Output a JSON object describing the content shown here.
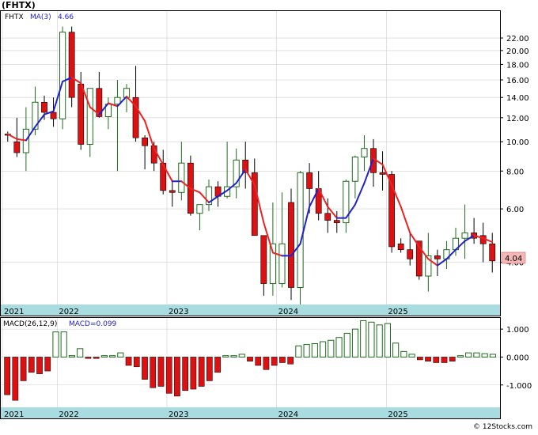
{
  "header": {
    "ticker_title": "(FHTX)",
    "legend_ticker": "FHTX",
    "legend_ma": "MA(3)",
    "legend_ma_value": "4.66"
  },
  "macd_panel": {
    "label": "MACD(26,12,9)",
    "value_label": "MACD=0.099"
  },
  "price_badge": "4.04",
  "watermark": "© 12Stocks.com",
  "colors": {
    "up": "#1f6b1f",
    "down": "#dd1111",
    "ma_up": "#2222cc",
    "ma_down": "#ee2222",
    "axis_band": "#a8dce0",
    "grid": "#cfcfcf",
    "badge_bg": "#f6b7b7"
  },
  "chart_data": [
    {
      "type": "candlestick",
      "title": "(FHTX)",
      "scale": "log",
      "grid": true,
      "ylim": [
        2.9,
        27
      ],
      "x_year_labels": [
        {
          "label": "2021",
          "index": 0
        },
        {
          "label": "2022",
          "index": 6
        },
        {
          "label": "2023",
          "index": 18
        },
        {
          "label": "2024",
          "index": 30
        },
        {
          "label": "2025",
          "index": 42
        }
      ],
      "y_ticks": [
        "22.00",
        "20.00",
        "18.00",
        "16.00",
        "14.00",
        "12.00",
        "10.00",
        "8.00",
        "6.00",
        "4.00"
      ],
      "series": [
        {
          "name": "FHTX",
          "ohlc": [
            [
              10.6,
              10.8,
              10.0,
              10.5
            ],
            [
              10.0,
              12.0,
              8.9,
              9.2
            ],
            [
              9.2,
              13.0,
              8.0,
              11.0
            ],
            [
              11.0,
              15.2,
              10.5,
              13.5
            ],
            [
              13.5,
              14.2,
              11.8,
              12.5
            ],
            [
              12.5,
              14.0,
              11.2,
              11.9
            ],
            [
              11.9,
              24.0,
              11.0,
              23.0
            ],
            [
              23.0,
              24.0,
              13.0,
              14.0
            ],
            [
              15.5,
              17.0,
              9.4,
              9.8
            ],
            [
              9.8,
              15.0,
              8.9,
              15.0
            ],
            [
              15.0,
              17.0,
              12.0,
              12.1
            ],
            [
              12.1,
              14.0,
              11.0,
              13.3
            ],
            [
              13.3,
              16.0,
              8.0,
              14.0
            ],
            [
              14.0,
              15.5,
              12.5,
              15.0
            ],
            [
              14.0,
              17.8,
              10.0,
              10.3
            ],
            [
              10.3,
              10.5,
              8.1,
              9.7
            ],
            [
              9.7,
              10.0,
              8.0,
              8.5
            ],
            [
              8.5,
              9.4,
              6.7,
              6.9
            ],
            [
              6.9,
              7.5,
              6.1,
              6.8
            ],
            [
              6.8,
              10.0,
              6.4,
              8.5
            ],
            [
              8.5,
              9.0,
              5.7,
              5.8
            ],
            [
              5.8,
              6.2,
              5.1,
              6.2
            ],
            [
              6.2,
              7.5,
              5.9,
              7.1
            ],
            [
              7.1,
              7.4,
              6.1,
              6.6
            ],
            [
              6.6,
              10.0,
              6.5,
              7.1
            ],
            [
              7.1,
              9.5,
              6.5,
              8.7
            ],
            [
              8.7,
              10.0,
              7.0,
              7.9
            ],
            [
              7.9,
              8.8,
              4.9,
              4.9
            ],
            [
              4.9,
              4.9,
              3.1,
              3.4
            ],
            [
              3.4,
              6.3,
              3.1,
              4.6
            ],
            [
              3.4,
              6.8,
              3.3,
              4.6
            ],
            [
              6.3,
              7.0,
              3.0,
              3.3
            ],
            [
              3.3,
              8.0,
              2.9,
              7.9
            ],
            [
              7.9,
              8.5,
              5.8,
              7.0
            ],
            [
              7.0,
              8.0,
              5.5,
              5.8
            ],
            [
              5.8,
              6.5,
              5.0,
              5.5
            ],
            [
              5.5,
              5.9,
              5.0,
              5.4
            ],
            [
              5.4,
              7.5,
              5.0,
              7.4
            ],
            [
              7.4,
              9.0,
              6.5,
              8.9
            ],
            [
              8.9,
              10.5,
              8.0,
              9.5
            ],
            [
              9.5,
              10.2,
              7.1,
              7.9
            ],
            [
              7.9,
              9.3,
              6.9,
              7.8
            ],
            [
              7.8,
              8.0,
              4.3,
              4.5
            ],
            [
              4.6,
              4.8,
              4.3,
              4.4
            ],
            [
              4.4,
              5.0,
              3.9,
              4.1
            ],
            [
              4.7,
              4.7,
              3.5,
              3.6
            ],
            [
              3.6,
              5.0,
              3.2,
              4.2
            ],
            [
              4.2,
              4.4,
              3.6,
              4.1
            ],
            [
              4.1,
              4.7,
              3.8,
              4.4
            ],
            [
              4.4,
              5.2,
              4.2,
              4.8
            ],
            [
              4.8,
              6.2,
              4.1,
              5.0
            ],
            [
              5.0,
              5.6,
              4.6,
              4.8
            ],
            [
              4.9,
              5.4,
              4.0,
              4.6
            ],
            [
              4.6,
              5.0,
              3.7,
              4.04
            ]
          ]
        },
        {
          "name": "MA(3)",
          "values": [
            10.6,
            10.2,
            10.1,
            11.2,
            12.3,
            12.6,
            15.8,
            16.3,
            15.6,
            13.0,
            12.3,
            13.4,
            13.1,
            14.1,
            13.1,
            11.7,
            9.5,
            8.4,
            7.4,
            7.4,
            7.0,
            6.8,
            6.3,
            6.6,
            6.9,
            7.3,
            8.1,
            7.2,
            5.4,
            4.3,
            4.2,
            4.2,
            4.6,
            6.1,
            7.0,
            6.1,
            5.6,
            5.6,
            6.2,
            7.3,
            8.8,
            8.4,
            7.2,
            6.1,
            5.0,
            4.5,
            4.1,
            3.9,
            4.1,
            4.4,
            4.7,
            4.9,
            4.8,
            4.66
          ]
        }
      ]
    },
    {
      "type": "bar",
      "title": "MACD(26,12,9)",
      "ylim": [
        -1.8,
        1.4
      ],
      "y_ticks": [
        "1.000",
        "0.000",
        "-1.000"
      ],
      "series": [
        {
          "name": "MACD",
          "values": [
            -1.35,
            -1.55,
            -0.85,
            -0.55,
            -0.6,
            -0.5,
            0.9,
            0.9,
            0.05,
            0.3,
            -0.05,
            -0.05,
            0.05,
            0.05,
            0.15,
            -0.3,
            -0.35,
            -0.8,
            -1.1,
            -1.05,
            -1.3,
            -1.4,
            -1.2,
            -1.15,
            -1.05,
            -0.85,
            -0.55,
            0.05,
            0.05,
            0.1,
            -0.15,
            -0.3,
            -0.45,
            -0.3,
            -0.2,
            -0.25,
            0.4,
            0.45,
            0.48,
            0.55,
            0.6,
            0.7,
            0.85,
            1.0,
            1.3,
            1.25,
            1.15,
            1.2,
            0.5,
            0.2,
            0.1,
            -0.1,
            -0.15,
            -0.2,
            -0.2,
            -0.15,
            0.05,
            0.15,
            0.15,
            0.12,
            0.099
          ]
        }
      ]
    }
  ]
}
